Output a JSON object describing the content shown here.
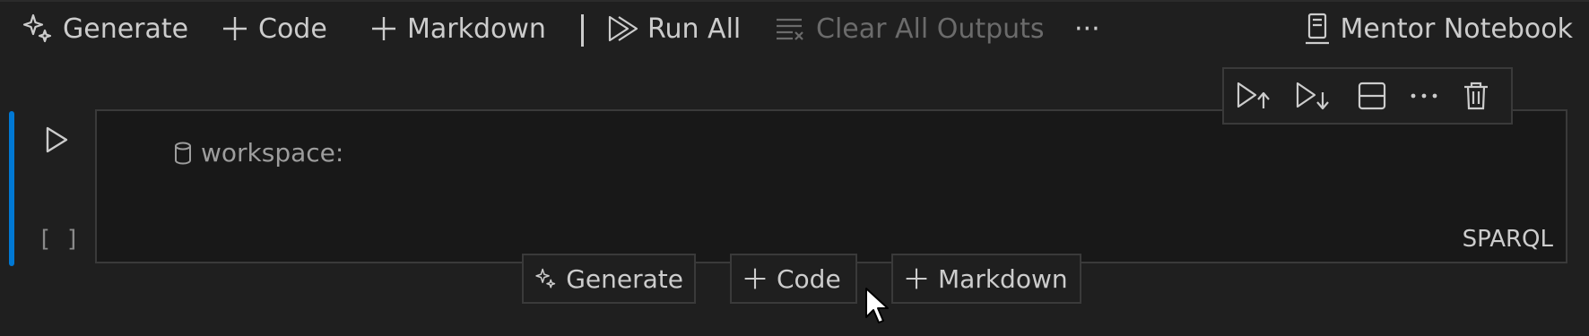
{
  "toolbar": {
    "generate_label": "Generate",
    "code_label": "Code",
    "markdown_label": "Markdown",
    "run_all_label": "Run All",
    "clear_outputs_label": "Clear All Outputs",
    "more_label": "···",
    "kernel_label": "Mentor Notebook"
  },
  "cell": {
    "execution_count": "[ ]",
    "workspace_label": "workspace:",
    "language": "SPARQL"
  },
  "insert_bar": {
    "generate_label": "Generate",
    "code_label": "Code",
    "markdown_label": "Markdown"
  },
  "colors": {
    "background": "#1f1f1f",
    "editor_background": "#181818",
    "accent": "#0078d4",
    "text": "#cccccc",
    "disabled_text": "#6b6b6b"
  }
}
